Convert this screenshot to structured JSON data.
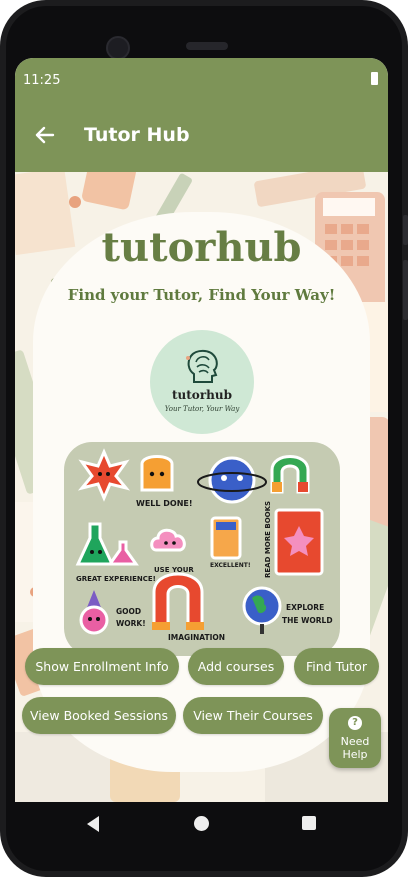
{
  "status_bar": {
    "time": "11:25"
  },
  "app_bar": {
    "title": "Tutor Hub"
  },
  "hero": {
    "brand": "tutorhub",
    "tagline": "Find your Tutor, Find Your Way!"
  },
  "logo": {
    "wordmark": "tutorhub",
    "tagline": "Your Tutor, Your Way"
  },
  "stickers": {
    "well_done": "WELL DONE!",
    "great_experience": "GREAT EXPERIENCE!",
    "use_your": "USE YOUR",
    "imagination": "IMAGINATION",
    "excellent": "EXCELLENT!",
    "read_more_books": "READ MORE BOOKS",
    "good_work_1": "GOOD",
    "good_work_2": "WORK!",
    "explore_1": "EXPLORE",
    "explore_2": "THE WORLD"
  },
  "buttons": {
    "show_enrollment": "Show Enrollment Info",
    "add_courses": "Add courses",
    "find_tutor": "Find Tutor",
    "view_booked": "View Booked Sessions",
    "view_courses": "View Their Courses"
  },
  "help": {
    "icon": "?",
    "label": "Need Help"
  },
  "colors": {
    "primary": "#7e9458",
    "brand_text": "#677e44",
    "panel": "#c5cbb2",
    "logo_circle": "#cfe8d5"
  },
  "icons": {
    "back": "arrow-left-icon",
    "battery": "battery-icon",
    "help": "question-icon",
    "nav_back": "triangle-back-icon",
    "nav_home": "circle-home-icon",
    "nav_recent": "square-recent-icon"
  }
}
